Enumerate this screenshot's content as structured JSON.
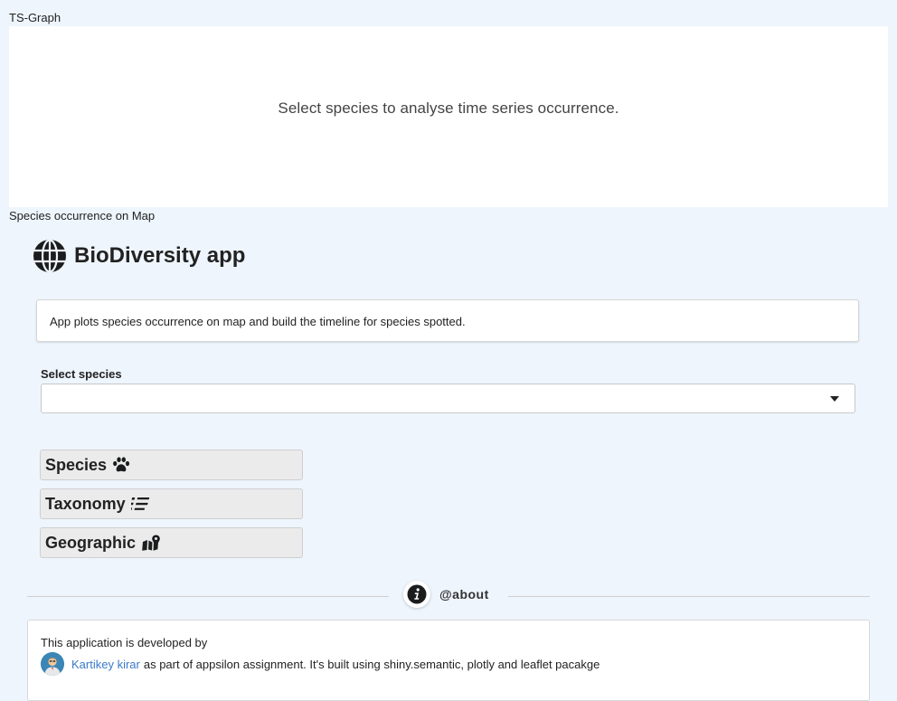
{
  "ts_graph": {
    "label": "TS-Graph",
    "placeholder_message": "Select species to analyse time series occurrence."
  },
  "map_section": {
    "label": "Species occurrence on Map"
  },
  "app": {
    "title": "BioDiversity app",
    "description": "App plots species occurrence on map and build the timeline for species spotted."
  },
  "species_select": {
    "label": "Select species",
    "value": ""
  },
  "tabs": [
    {
      "label": "Species",
      "icon": "paw-icon"
    },
    {
      "label": "Taxonomy",
      "icon": "list-icon"
    },
    {
      "label": "Geographic",
      "icon": "map-marked-icon"
    }
  ],
  "about": {
    "divider_text": "@about",
    "line1": "This application is developed by",
    "developer_name": "Kartikey kirar",
    "line2_rest": "as part of appsilon assignment. It's built using shiny.semantic, plotly and leaflet pacakge"
  },
  "colors": {
    "background": "#eef5fd",
    "link": "#3a7bc8",
    "avatar_bg": "#3b86b5"
  }
}
